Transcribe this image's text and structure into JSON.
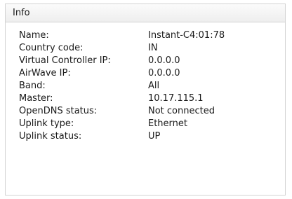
{
  "panel": {
    "title": "Info"
  },
  "info": {
    "rows": [
      {
        "label": "Name:",
        "value": "Instant-C4:01:78"
      },
      {
        "label": "Country code:",
        "value": "IN"
      },
      {
        "label": "Virtual Controller IP:",
        "value": "0.0.0.0"
      },
      {
        "label": "AirWave IP:",
        "value": "0.0.0.0"
      },
      {
        "label": "Band:",
        "value": "All"
      },
      {
        "label": "Master:",
        "value": "10.17.115.1"
      },
      {
        "label": "OpenDNS status:",
        "value": "Not connected"
      },
      {
        "label": "Uplink type:",
        "value": "Ethernet"
      },
      {
        "label": "Uplink status:",
        "value": "UP"
      }
    ]
  }
}
